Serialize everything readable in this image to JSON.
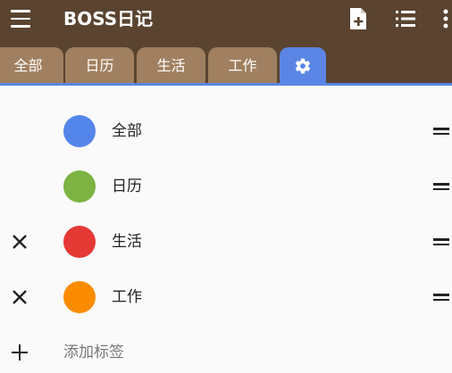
{
  "app": {
    "title": "BOSS日记"
  },
  "toolbar": {
    "icons": [
      "menu-icon",
      "new-document-icon",
      "list-icon",
      "more-vert-icon"
    ]
  },
  "tabs": [
    {
      "label": "全部"
    },
    {
      "label": "日历"
    },
    {
      "label": "生活"
    },
    {
      "label": "工作"
    },
    {
      "label": "",
      "icon": "gear-icon",
      "active": true
    }
  ],
  "tags": [
    {
      "label": "全部",
      "color": "#5485ea",
      "deletable": false
    },
    {
      "label": "日历",
      "color": "#7cb342",
      "deletable": false
    },
    {
      "label": "生活",
      "color": "#e53935",
      "deletable": true
    },
    {
      "label": "工作",
      "color": "#fb8c00",
      "deletable": true
    }
  ],
  "add_tag": {
    "label": "添加标签"
  },
  "colors": {
    "appbar": "#5a4430",
    "tab": "#a08060",
    "tab_active": "#5b86e5"
  }
}
